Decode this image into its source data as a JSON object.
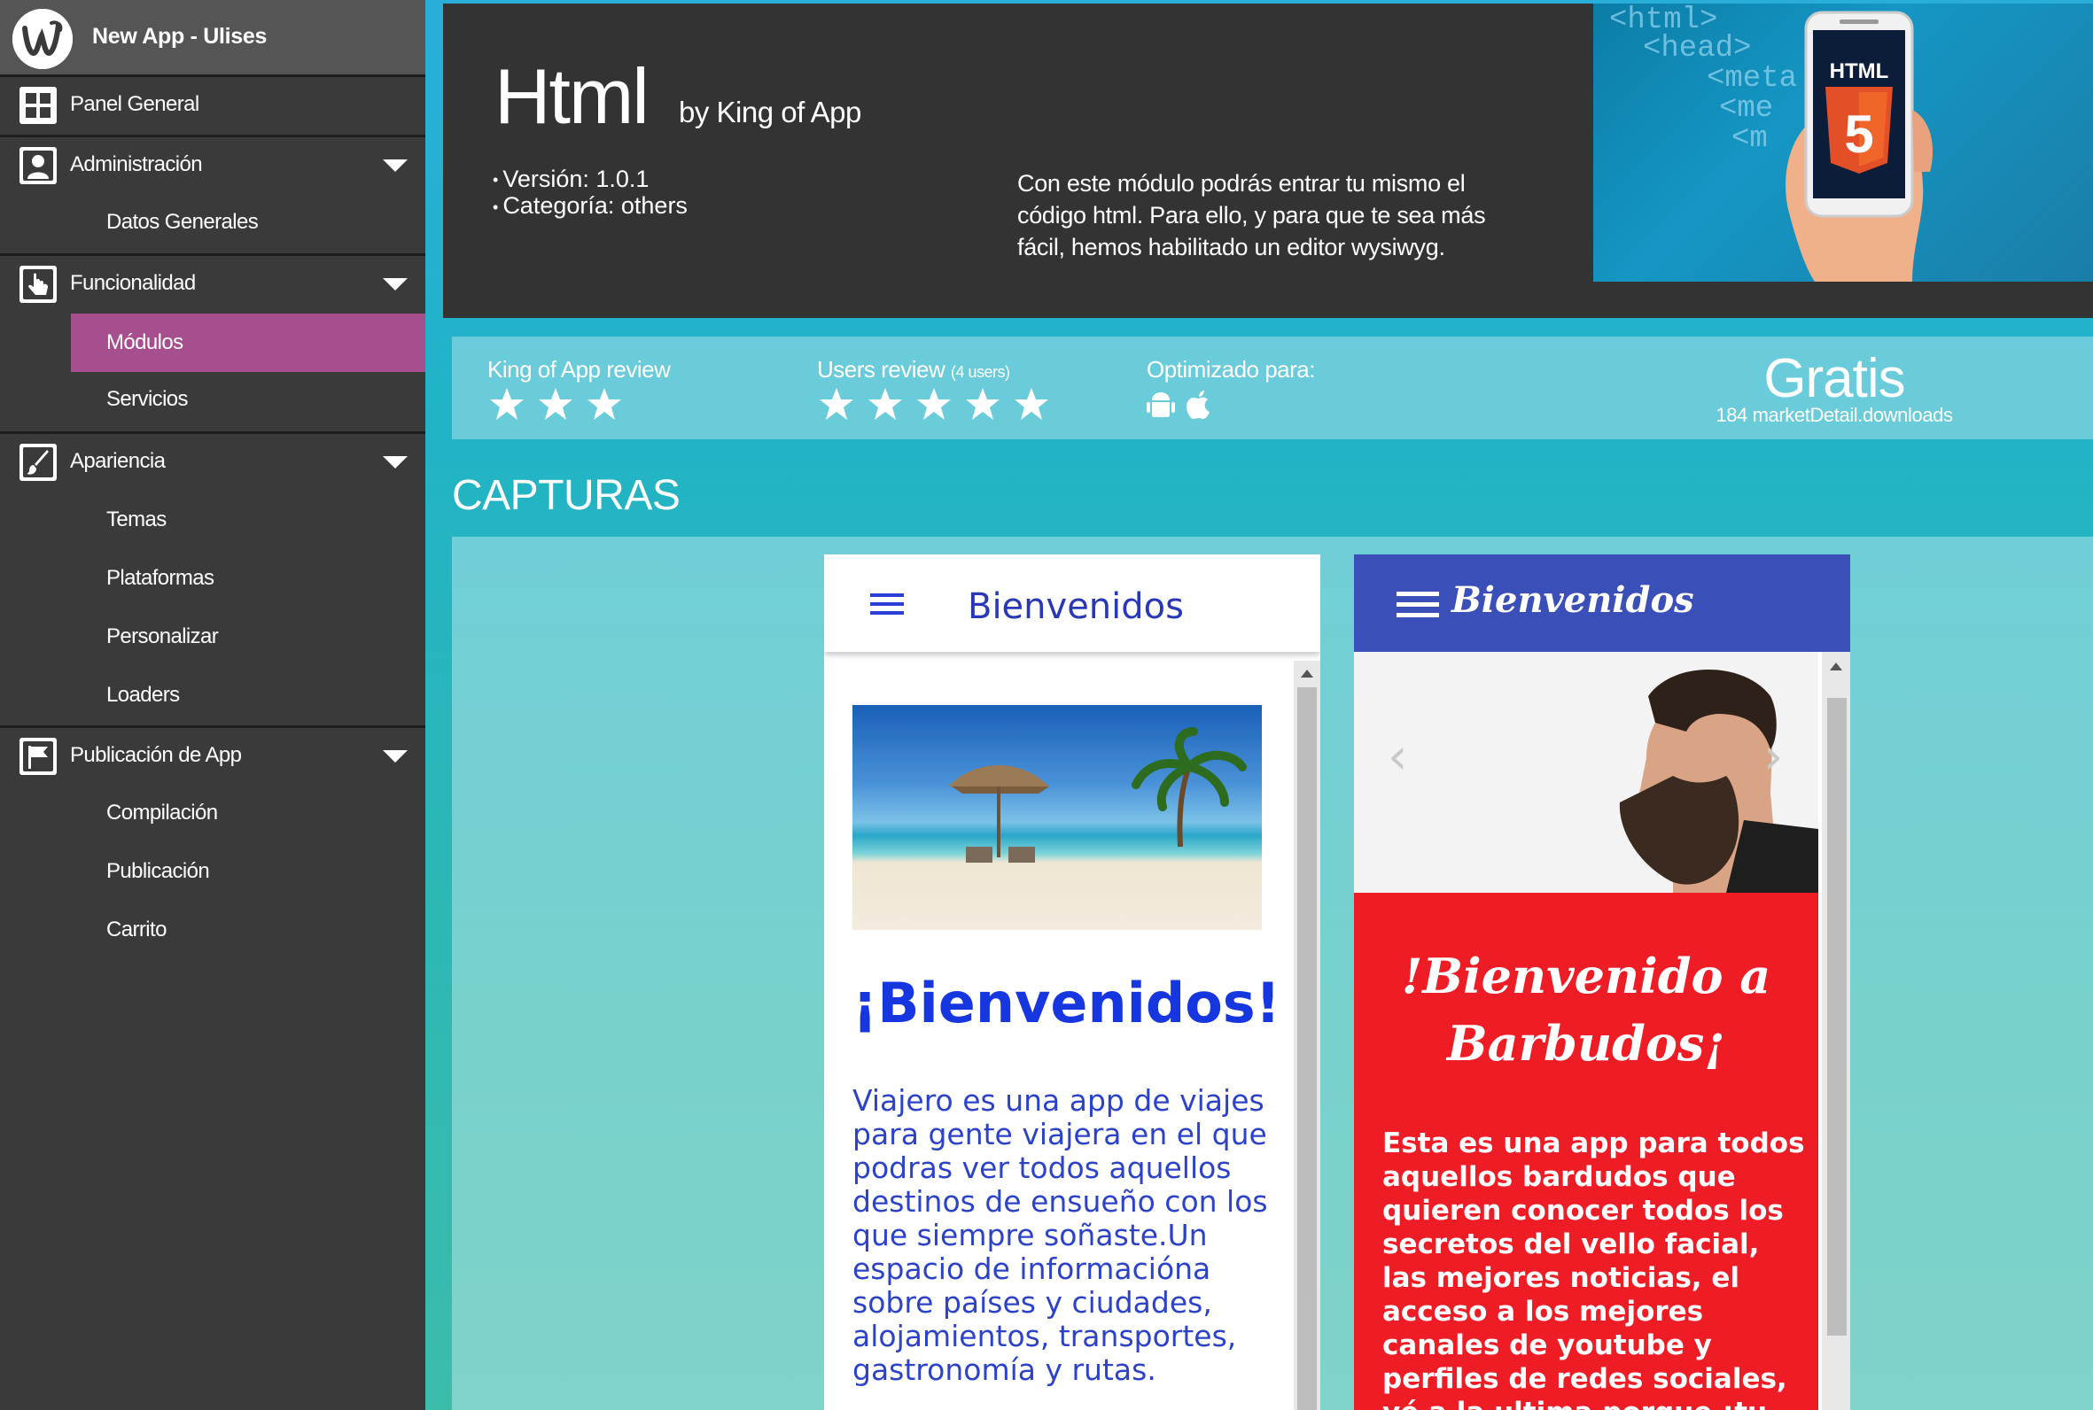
{
  "app": {
    "name": "New App - Ulises"
  },
  "sidebar": {
    "items": [
      {
        "label": "Panel General",
        "icon": "dashboard-icon"
      },
      {
        "label": "Administración",
        "icon": "user-icon",
        "children": [
          "Datos Generales"
        ]
      },
      {
        "label": "Funcionalidad",
        "icon": "hand-pointer-icon",
        "children": [
          "Módulos",
          "Servicios"
        ]
      },
      {
        "label": "Apariencia",
        "icon": "brush-icon",
        "children": [
          "Temas",
          "Plataformas",
          "Personalizar",
          "Loaders"
        ]
      },
      {
        "label": "Publicación de App",
        "icon": "flag-icon",
        "children": [
          "Compilación",
          "Publicación",
          "Carrito"
        ]
      }
    ],
    "active": "Módulos",
    "active_color": "#a64f8f"
  },
  "module": {
    "title": "Html",
    "by": "by King of App",
    "version": "Versión: 1.0.1",
    "category": "Categoría: others",
    "description": "Con este módulo podrás entrar tu mismo el código html. Para ello, y para que te sea más fácil, hemos habilitado un editor wysiwyg.",
    "hero_code": [
      "<html>",
      "<head>",
      "<meta",
      "<me",
      "<m"
    ],
    "hero_badge": "HTML",
    "hero_badge_number": "5"
  },
  "review": {
    "king_label": "King of App review",
    "king_stars": 3,
    "users_label": "Users review",
    "users_count": "(4 users)",
    "users_stars": 5,
    "optimized_label": "Optimizado para:",
    "platforms": [
      "android-icon",
      "apple-icon"
    ],
    "price": "Gratis",
    "downloads": "184 marketDetail.downloads"
  },
  "captures": {
    "title": "CAPTURAS",
    "shot1": {
      "header_title": "Bienvenidos",
      "heading": "¡Bienvenidos!",
      "text": "Viajero es una app de viajes para gente viajera en el que podras ver todos aquellos destinos de ensueño con los que siempre soñaste.Un espacio de informacióna sobre países y ciudades, alojamientos, transportes, gastronomía y rutas."
    },
    "shot2": {
      "header_title": "Bienvenidos",
      "heading": "!Bienvenido a Barbudos¡",
      "text": "Esta es una app para todos aquellos bardudos que quieren conocer todos los secretos del vello facial, las mejores noticias, el acceso a los mejores canales de youtube y perfiles de redes sociales, vé a la ultima porque ¡tu barba dice"
    }
  },
  "colors": {
    "sidebar_bg": "#3a3a3a",
    "hero_bg": "#333333",
    "accent_teal": "#21b3c8",
    "shot1_blue": "#1637e0",
    "shot2_header": "#3b4fb8",
    "shot2_red": "#ee1c25"
  }
}
